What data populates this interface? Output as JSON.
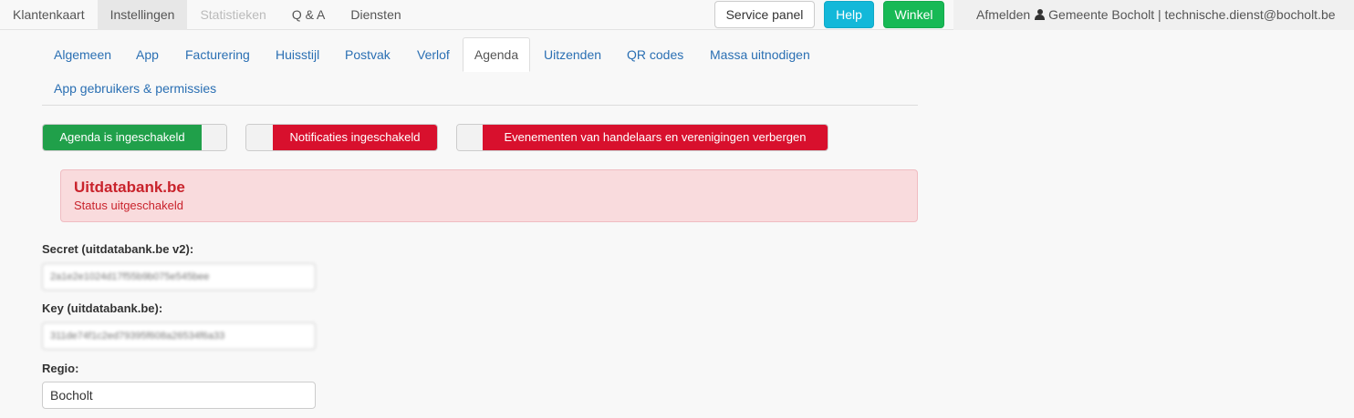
{
  "navbar": {
    "items": [
      {
        "label": "Klantenkaart",
        "state": "normal"
      },
      {
        "label": "Instellingen",
        "state": "active"
      },
      {
        "label": "Statistieken",
        "state": "disabled"
      },
      {
        "label": "Q & A",
        "state": "normal"
      },
      {
        "label": "Diensten",
        "state": "normal"
      }
    ],
    "buttons": {
      "service_panel": "Service panel",
      "help": "Help",
      "winkel": "Winkel"
    },
    "logout": "Afmelden",
    "user_icon": "user-icon",
    "account": "Gemeente Bocholt | technische.dienst@bocholt.be"
  },
  "tabs": [
    {
      "label": "Algemeen",
      "active": false
    },
    {
      "label": "App",
      "active": false
    },
    {
      "label": "Facturering",
      "active": false
    },
    {
      "label": "Huisstijl",
      "active": false
    },
    {
      "label": "Postvak",
      "active": false
    },
    {
      "label": "Verlof",
      "active": false
    },
    {
      "label": "Agenda",
      "active": true
    },
    {
      "label": "Uitzenden",
      "active": false
    },
    {
      "label": "QR codes",
      "active": false
    },
    {
      "label": "Massa uitnodigen",
      "active": false
    },
    {
      "label": "App gebruikers & permissies",
      "active": false
    }
  ],
  "toggles": [
    {
      "label": "Agenda is ingeschakeld",
      "state": "on",
      "color": "#20a04a"
    },
    {
      "label": "Notificaties ingeschakeld",
      "state": "off",
      "color": "#d8102d"
    },
    {
      "label": "Evenementen van handelaars en verenigingen verbergen",
      "state": "off",
      "color": "#d8102d"
    }
  ],
  "alert": {
    "title": "Uitdatabank.be",
    "status": "Status uitgeschakeld",
    "color": "#c9232c"
  },
  "form": {
    "secret_label": "Secret (uitdatabank.be v2):",
    "secret_value": "2a1e2e1024d17f55b9b075e545bee",
    "key_label": "Key (uitdatabank.be):",
    "key_value": "311de74f1c2ed79395f608a26534f6a33",
    "regio_label": "Regio:",
    "regio_value": "Bocholt"
  },
  "colors": {
    "link": "#2a6fb3",
    "help": "#13b8d9",
    "winkel": "#17b955"
  }
}
